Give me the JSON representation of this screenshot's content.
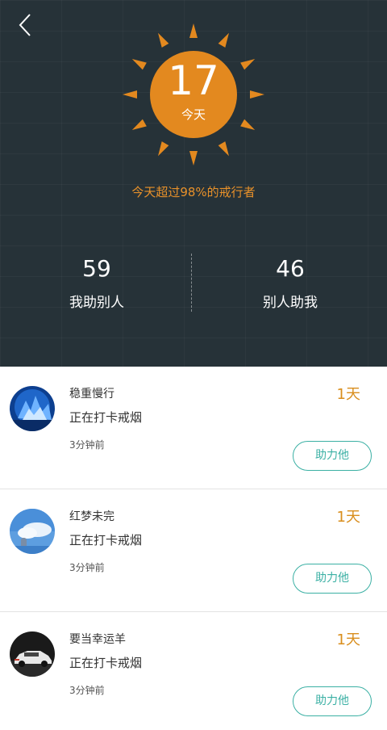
{
  "header": {
    "days_count": "17",
    "days_label": "今天",
    "rank_text": "今天超过98%的戒行者",
    "stats": [
      {
        "value": "59",
        "label": "我助别人"
      },
      {
        "value": "46",
        "label": "别人助我"
      }
    ]
  },
  "colors": {
    "accent_orange": "#e8912a",
    "sun_orange": "#e3891f",
    "teal": "#3bb0a4",
    "header_bg": "#263238"
  },
  "feed": [
    {
      "name": "稳重慢行",
      "status": "正在打卡戒烟",
      "time": "3分钟前",
      "days": "1天",
      "button": "助力他"
    },
    {
      "name": "红梦未完",
      "status": "正在打卡戒烟",
      "time": "3分钟前",
      "days": "1天",
      "button": "助力他"
    },
    {
      "name": "要当幸运羊",
      "status": "正在打卡戒烟",
      "time": "3分钟前",
      "days": "1天",
      "button": "助力他"
    }
  ]
}
